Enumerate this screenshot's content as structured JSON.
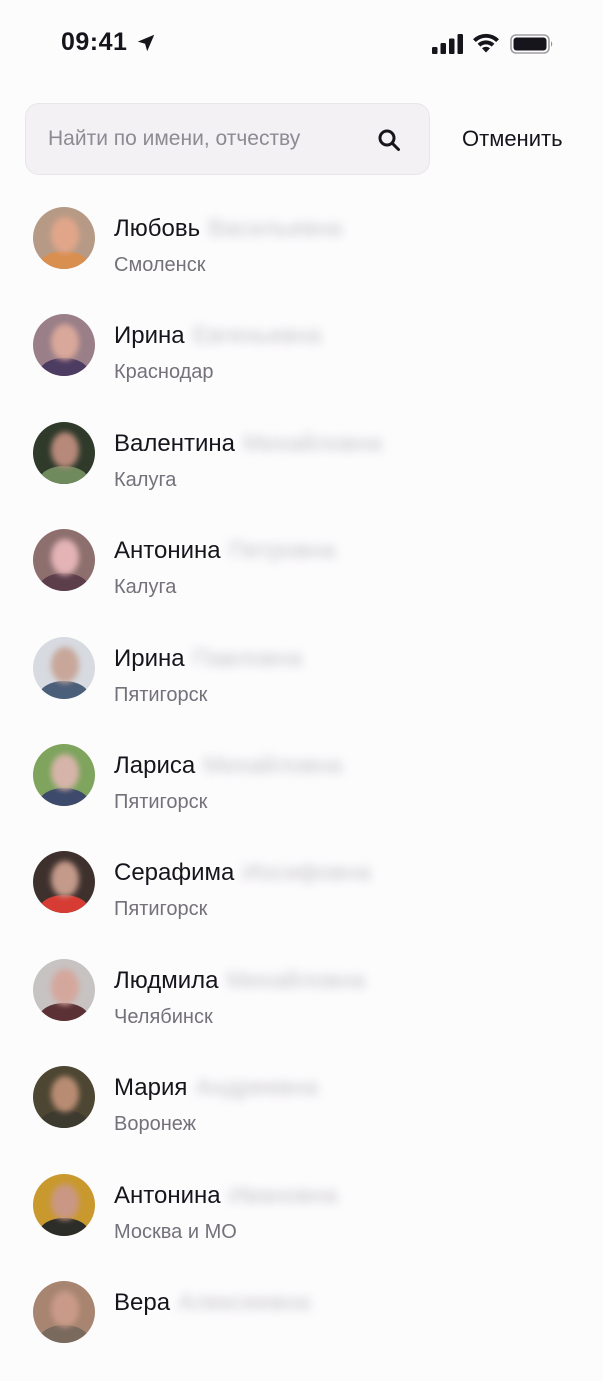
{
  "status_bar": {
    "time": "09:41"
  },
  "search": {
    "placeholder": "Найти по имени, отчеству",
    "cancel_label": "Отменить"
  },
  "results": [
    {
      "first_name": "Любовь",
      "last_name": "Васильевна",
      "city": "Смоленск",
      "avatar_bg": "#b79a86",
      "avatar_face": "#e1a68a",
      "avatar_body": "#d98f4f"
    },
    {
      "first_name": "Ирина",
      "last_name": "Евгеньевна",
      "city": "Краснодар",
      "avatar_bg": "#9a7f88",
      "avatar_face": "#d9a89a",
      "avatar_body": "#4d3c62"
    },
    {
      "first_name": "Валентина",
      "last_name": "Михайловна",
      "city": "Калуга",
      "avatar_bg": "#2f3a2a",
      "avatar_face": "#b7897a",
      "avatar_body": "#6f8a5d"
    },
    {
      "first_name": "Антонина",
      "last_name": "Петровна",
      "city": "Калуга",
      "avatar_bg": "#8d6f6e",
      "avatar_face": "#e3b3b6",
      "avatar_body": "#5c3e4b"
    },
    {
      "first_name": "Ирина",
      "last_name": "Павловна",
      "city": "Пятигорск",
      "avatar_bg": "#d7dae0",
      "avatar_face": "#c8a79a",
      "avatar_body": "#4b5f7a"
    },
    {
      "first_name": "Лариса",
      "last_name": "Михайловна",
      "city": "Пятигорск",
      "avatar_bg": "#7ea45d",
      "avatar_face": "#d7b4a9",
      "avatar_body": "#3d4a6b"
    },
    {
      "first_name": "Серафима",
      "last_name": "Иосифовна",
      "city": "Пятигорск",
      "avatar_bg": "#3e312d",
      "avatar_face": "#c49a8a",
      "avatar_body": "#d63c34"
    },
    {
      "first_name": "Людмила",
      "last_name": "Михайловна",
      "city": "Челябинск",
      "avatar_bg": "#c8c3c3",
      "avatar_face": "#d4a79c",
      "avatar_body": "#5b3136"
    },
    {
      "first_name": "Мария",
      "last_name": "Андреевна",
      "city": "Воронеж",
      "avatar_bg": "#4d4632",
      "avatar_face": "#b88c72",
      "avatar_body": "#3d3a30"
    },
    {
      "first_name": "Антонина",
      "last_name": "Ивановна",
      "city": "Москва и МО",
      "avatar_bg": "#c9992e",
      "avatar_face": "#c99783",
      "avatar_body": "#2c2c28"
    },
    {
      "first_name": "Вера",
      "last_name": "Алексеевна",
      "city": "",
      "avatar_bg": "#a88570",
      "avatar_face": "#c99a88",
      "avatar_body": "#7a6a5e"
    }
  ]
}
